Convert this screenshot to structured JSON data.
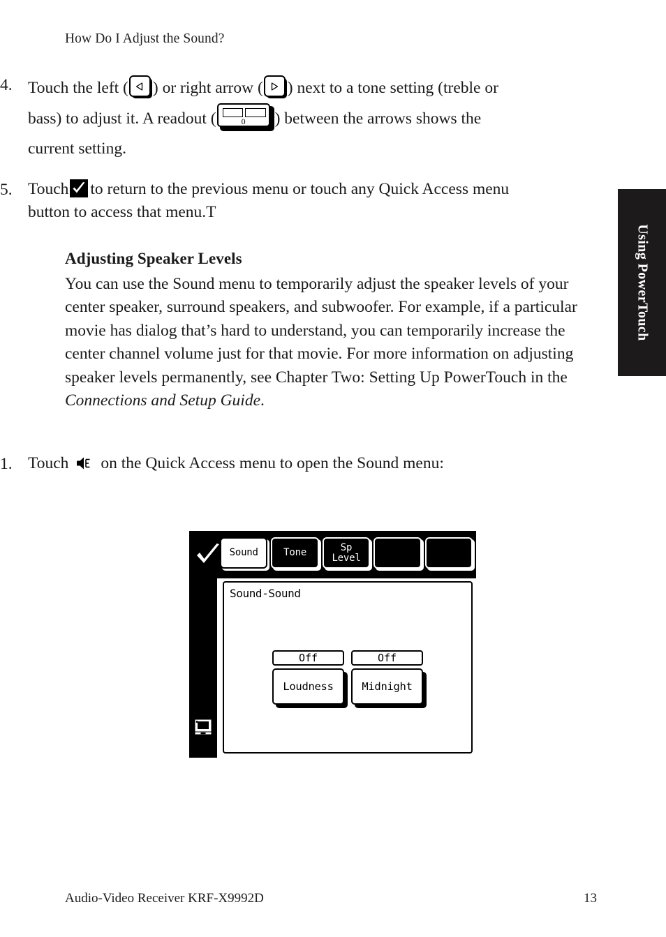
{
  "running_head": "How Do I Adjust the Sound?",
  "thumb_tab": {
    "label": "Using PowerTouch"
  },
  "steps": {
    "item4": {
      "number": "4.",
      "text_a": "Touch the left (",
      "text_b": ") or right arrow (",
      "text_c": ") next to a tone setting (treble or bass) to adjust it. A readout (",
      "text_d": ") between the arrows shows the current setting.",
      "readout_value": "0"
    },
    "item5": {
      "number": "5.",
      "text_a": "Touch",
      "text_b": "to return to the previous menu or touch any Quick Access menu button to access that menu.T"
    },
    "item1": {
      "number": "1.",
      "text_a": "Touch",
      "text_b": "on the Quick Access menu to open the Sound menu:"
    }
  },
  "section": {
    "heading": "Adjusting Speaker Levels",
    "paragraph_a": "You can use the Sound menu to temporarily adjust the speaker levels of your center speaker, surround speakers, and subwoofer. For example, if a particular movie has dialog that’s hard to understand, you can temporarily increase the center channel volume just for that movie. For more information on adjusting speaker levels permanently, see Chapter Two: Setting Up PowerTouch in the ",
    "paragraph_italic": "Connections and Setup Guide",
    "paragraph_b": "."
  },
  "device": {
    "tabs": [
      {
        "label": "Sound",
        "selected": true
      },
      {
        "label": "Tone",
        "selected": false
      },
      {
        "label": "Sp\nLevel",
        "selected": false
      },
      {
        "label": "",
        "selected": false
      },
      {
        "label": "",
        "selected": false
      }
    ],
    "panel_title": "Sound-Sound",
    "controls": [
      {
        "value": "Off",
        "label": "Loudness"
      },
      {
        "value": "Off",
        "label": "Midnight"
      }
    ]
  },
  "footer": {
    "left": "Audio-Video Receiver KRF-X9992D",
    "right": "13"
  }
}
